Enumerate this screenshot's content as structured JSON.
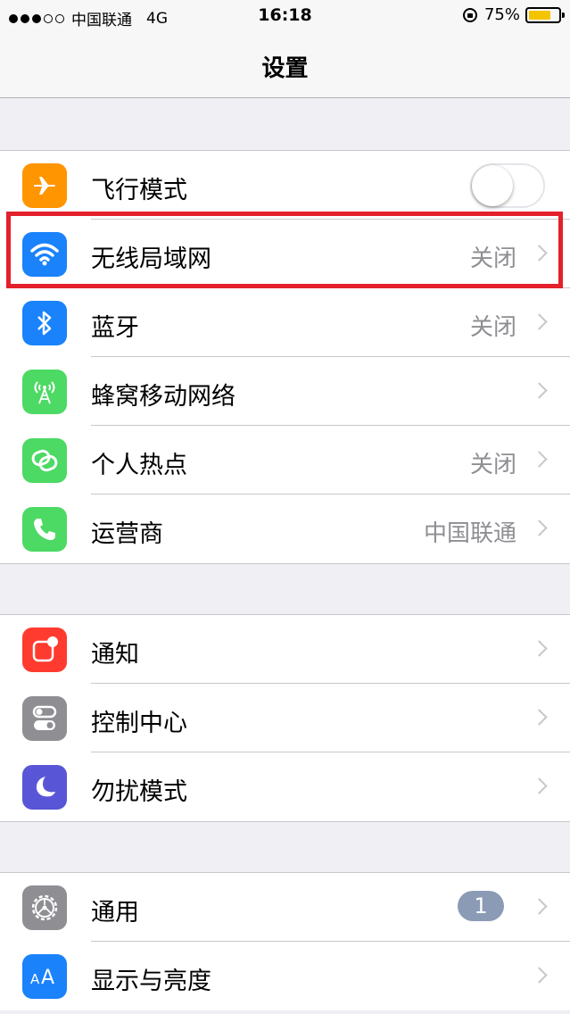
{
  "status_bar": {
    "carrier": "中国联通",
    "network": "4G",
    "time": "16:18",
    "battery": "75%",
    "battery_level": 0.75
  },
  "nav": {
    "title": "设置"
  },
  "groups": [
    {
      "rows": [
        {
          "label": "飞行模式",
          "icon": "airplane-icon",
          "color": "#ff9500",
          "toggle": false
        },
        {
          "label": "无线局域网",
          "value": "关闭",
          "icon": "wifi-icon",
          "color": "#1a82fb",
          "highlighted": true
        },
        {
          "label": "蓝牙",
          "value": "关闭",
          "icon": "bluetooth-icon",
          "color": "#1a82fb"
        },
        {
          "label": "蜂窝移动网络",
          "value": "",
          "icon": "cellular-icon",
          "color": "#4cd964"
        },
        {
          "label": "个人热点",
          "value": "关闭",
          "icon": "hotspot-icon",
          "color": "#4cd964"
        },
        {
          "label": "运营商",
          "value": "中国联通",
          "icon": "phone-icon",
          "color": "#4cd964"
        }
      ]
    },
    {
      "rows": [
        {
          "label": "通知",
          "icon": "notification-icon",
          "color": "#ff3b30"
        },
        {
          "label": "控制中心",
          "icon": "control-center-icon",
          "color": "#8e8e93"
        },
        {
          "label": "勿扰模式",
          "icon": "moon-icon",
          "color": "#5856d6"
        }
      ]
    },
    {
      "rows": [
        {
          "label": "通用",
          "badge": "1",
          "icon": "gear-icon",
          "color": "#8e8e93"
        },
        {
          "label": "显示与亮度",
          "icon": "display-icon",
          "color": "#1a82fb"
        }
      ]
    }
  ]
}
